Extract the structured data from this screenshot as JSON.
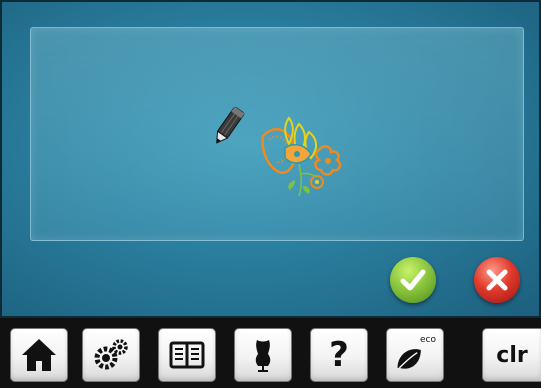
{
  "toolbar": {
    "help_label": "?",
    "eco_label": "eco",
    "clr_label": "clr"
  },
  "icons": {
    "pencil": "pencil-icon",
    "motif": "embroidery-motif",
    "confirm": "checkmark-icon",
    "cancel": "close-icon",
    "home": "home-icon",
    "setup": "gears-icon",
    "tutorial": "book-icon",
    "consultant": "dress-form-icon",
    "help": "question-icon",
    "eco": "leaf-icon"
  },
  "colors": {
    "screen_bg": "#2a7e9e",
    "confirm": "#8cc63f",
    "cancel": "#e03a2a",
    "motif_orange": "#f08a1c",
    "motif_yellow": "#e8d21a",
    "motif_green": "#7fc241"
  }
}
